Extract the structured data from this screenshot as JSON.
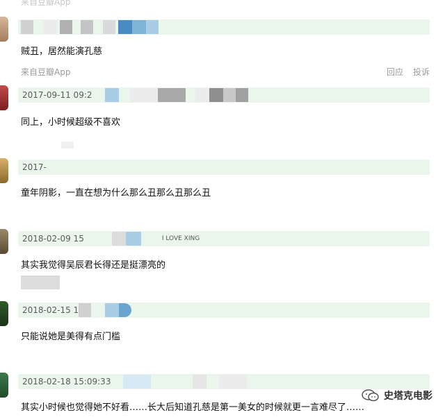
{
  "top": {
    "source": "来自豆瓣App"
  },
  "comments": [
    {
      "date": "",
      "text": "贼丑，居然能演孔慈",
      "source": "来自豆瓣App",
      "reply": "回应",
      "report": "投诉"
    },
    {
      "date": "2017-09-11 09:2",
      "text": "同上，小时候超级不喜欢"
    },
    {
      "date": "2017-",
      "text": "童年阴影，一直在想为什么那么丑那么丑那么丑"
    },
    {
      "date": "2018-02-09 15",
      "username_fragment": "I LOVE XING",
      "text": "其实我觉得吴辰君长得还是挺漂亮的"
    },
    {
      "date": "2018-02-15 1",
      "text": "只能说她是美得有点门槛"
    },
    {
      "date": "2018-02-18 15:09:33",
      "text": "其实小时候也觉得她不好看……长大后知道孔慈是第一美女的时候就更一言难尽了……"
    }
  ],
  "watermark": {
    "label": "史塔克电影",
    "icon": "wechat-icon"
  },
  "colors": {
    "meta_bar": "#eaf6ec",
    "muted": "#9a9a9a",
    "blue_blur": "#7fb4d8"
  }
}
